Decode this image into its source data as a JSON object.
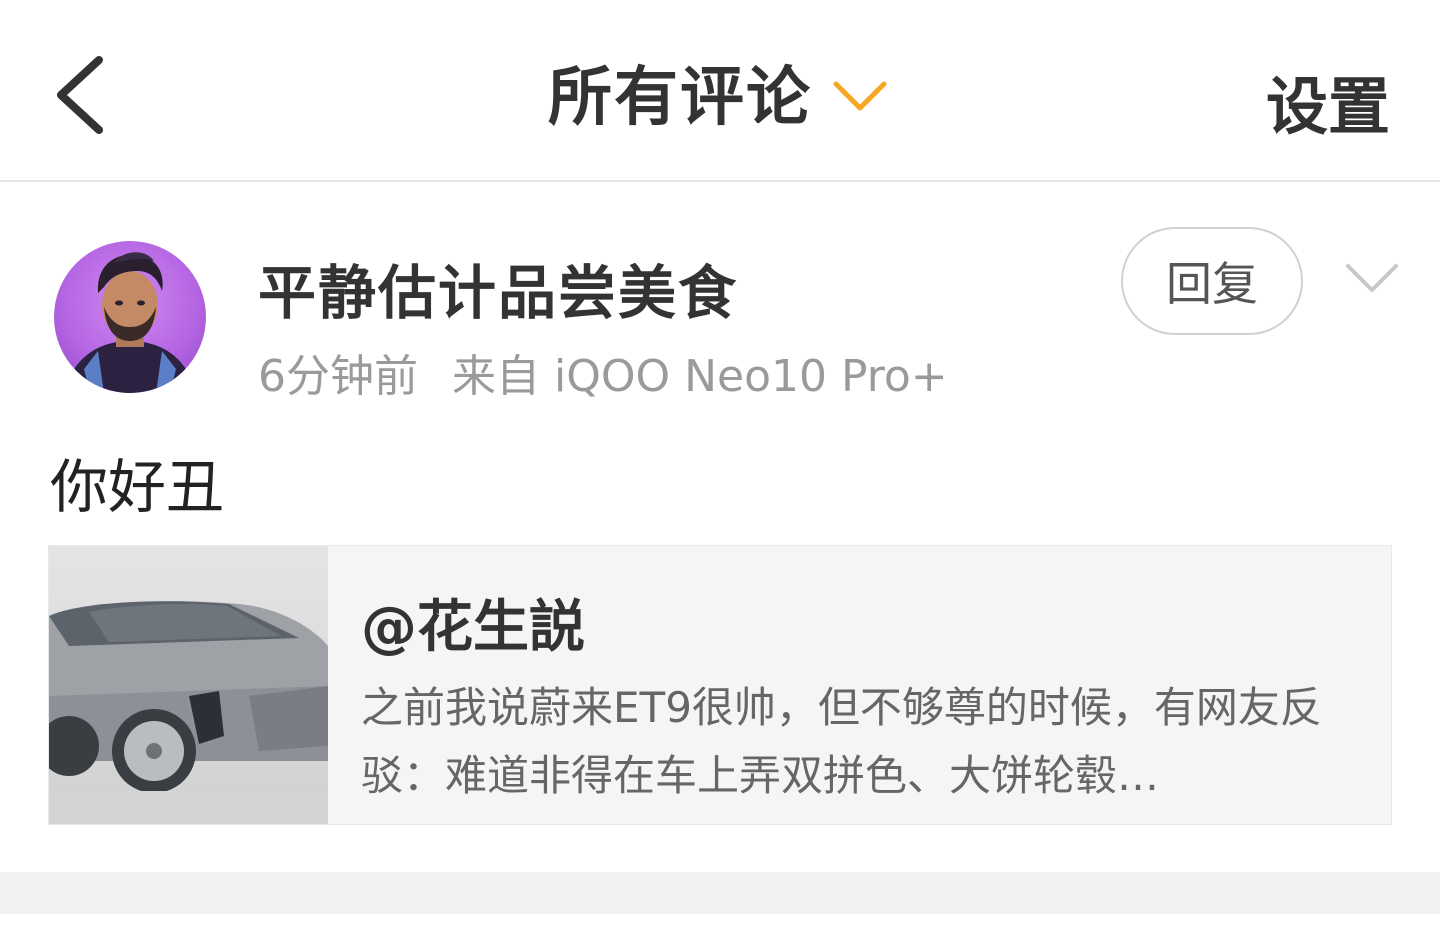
{
  "header": {
    "title": "所有评论",
    "settings_label": "设置",
    "back_icon": "chevron-left-icon",
    "title_dropdown_icon": "chevron-down-icon",
    "accent_color": "#F5A623"
  },
  "comment": {
    "username": "平静估计品尝美食",
    "time": "6分钟前",
    "source": "来自 iQOO Neo10 Pro+",
    "reply_label": "回复",
    "more_icon": "chevron-down-icon",
    "text": "你好丑"
  },
  "quoted_post": {
    "author": "@花生説",
    "excerpt": "之前我说蔚来ET9很帅，但不够尊的时候，有网友反驳：难道非得在车上弄双拼色、大饼轮毂…",
    "thumbnail": "car-image"
  }
}
